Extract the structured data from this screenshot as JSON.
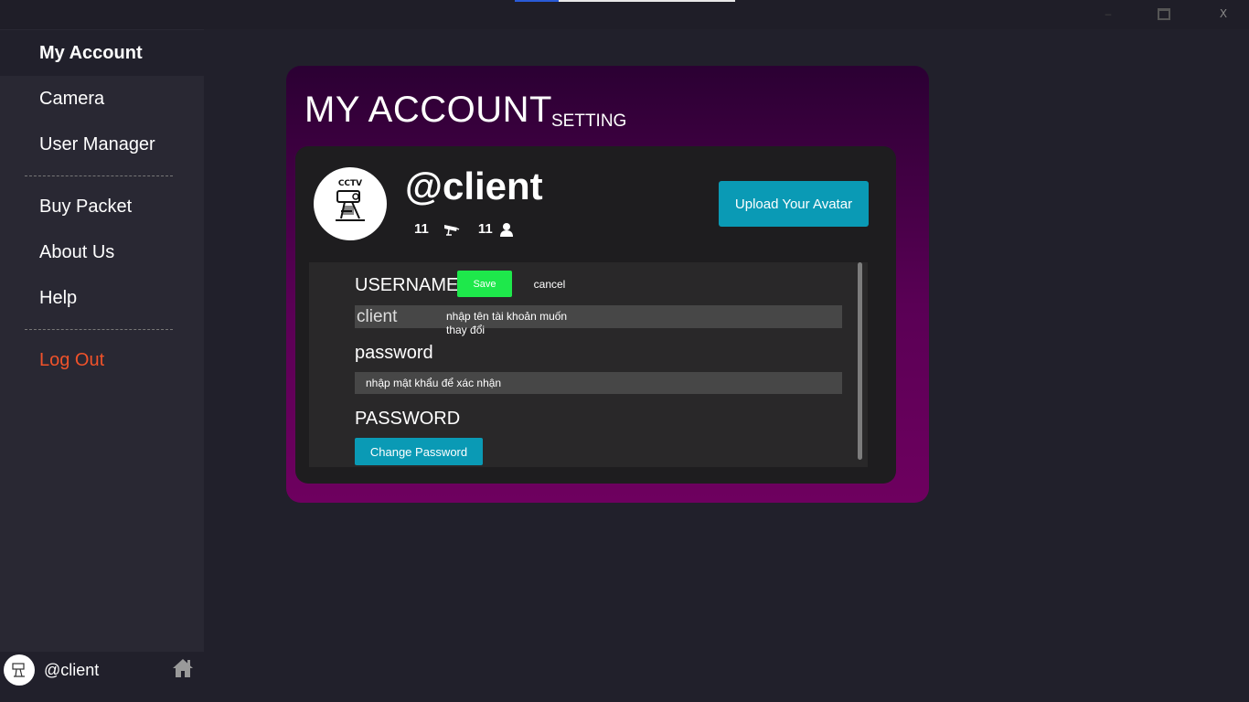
{
  "window": {
    "minimize": "–",
    "maximize": "",
    "close": "X"
  },
  "sidebar": {
    "items": [
      {
        "label": "My Account",
        "active": true
      },
      {
        "label": "Camera"
      },
      {
        "label": "User Manager"
      },
      {
        "label": "Buy Packet"
      },
      {
        "label": "About Us"
      },
      {
        "label": "Help"
      },
      {
        "label": "Log Out",
        "color": "#f0522a"
      }
    ],
    "user": {
      "name": "@client",
      "icon": "home-icon"
    }
  },
  "account": {
    "title": "MY ACCOUNT",
    "subtitle": "SETTING",
    "handle": "@client",
    "camera_count": "11",
    "user_count": "11",
    "upload_label": "Upload Your Avatar",
    "avatar_text": "CCTV"
  },
  "form": {
    "username_label": "USERNAME",
    "save_label": "Save",
    "cancel_label": "cancel",
    "username_value": "client",
    "username_hint": "nhập tên tài khoản muốn thay đổi",
    "password_label": "password",
    "password_placeholder": "nhập mật khẩu để xác nhận",
    "password_section_label": "PASSWORD",
    "change_password_label": "Change Password"
  },
  "colors": {
    "accent": "#0a9ab5",
    "save": "#1ee84b",
    "logout": "#f0522a",
    "card_top": "#2b0033",
    "card_bottom": "#6e005f"
  }
}
